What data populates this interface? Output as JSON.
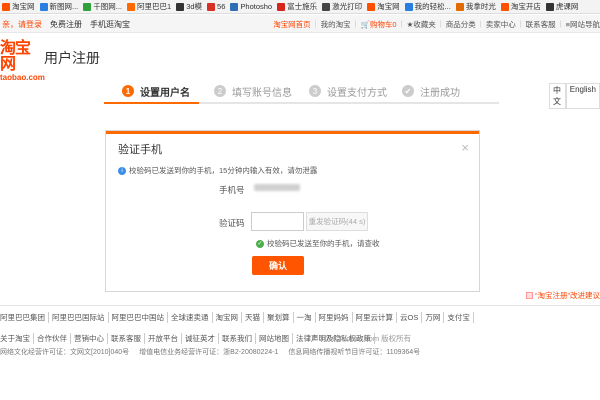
{
  "bookmarks": [
    {
      "label": "淘宝网",
      "color": "#ff5000"
    },
    {
      "label": "新图网...",
      "color": "#2a7de1"
    },
    {
      "label": "千图网...",
      "color": "#30a13a"
    },
    {
      "label": "阿里巴巴1",
      "color": "#ff6a00"
    },
    {
      "label": "3d模",
      "color": "#333333"
    },
    {
      "label": "56",
      "color": "#d93025"
    },
    {
      "label": "Photosho",
      "color": "#2c6fb5"
    },
    {
      "label": "富士施乐",
      "color": "#d6251b"
    },
    {
      "label": "激光打印",
      "color": "#444444"
    },
    {
      "label": "淘宝网",
      "color": "#ff5000"
    },
    {
      "label": "我的轻松...",
      "color": "#2a7de1"
    },
    {
      "label": "我拿时光",
      "color": "#e26b00"
    },
    {
      "label": "淘宝开店",
      "color": "#ff5000"
    },
    {
      "label": "虎课网",
      "color": "#333333"
    }
  ],
  "topnav": {
    "greeting": "亲，请登录",
    "register": "免费注册",
    "mobile": "手机逛淘宝",
    "right": [
      "淘宝网首页",
      "我的淘宝",
      "购物车0",
      "收藏夹",
      "商品分类",
      "卖家中心",
      "联系客服",
      "网站导航"
    ]
  },
  "header": {
    "logo_cn": "淘宝网",
    "logo_en": "taobao.com",
    "title": "用户注册"
  },
  "steps": [
    {
      "num": "1",
      "label": "设置用户名",
      "active": true
    },
    {
      "num": "2",
      "label": "填写账号信息",
      "active": false
    },
    {
      "num": "3",
      "label": "设置支付方式",
      "active": false
    },
    {
      "num": "✔",
      "label": "注册成功",
      "active": false
    }
  ],
  "lang": {
    "zh": "中文",
    "en": "English"
  },
  "dialog": {
    "title": "验证手机",
    "close_icon": "×",
    "info_text": "校验码已发送到你的手机，15分钟内输入有效，请勿泄露",
    "phone_label": "手机号",
    "code_label": "验证码",
    "code_placeholder": "",
    "resend_label": "重发验证码(44 s)",
    "sent_ok": "校验码已发送至你的手机，请查收",
    "confirm_label": "确认"
  },
  "feedback": "“淘宝注册”改进建议",
  "footer_links": [
    "阿里巴巴集团",
    "阿里巴巴国际站",
    "阿里巴巴中国站",
    "全球速卖通",
    "淘宝网",
    "天猫",
    "聚划算",
    "一淘",
    "阿里妈妈",
    "阿里云计算",
    "云OS",
    "万网",
    "支付宝"
  ],
  "footer_links2": [
    "关于淘宝",
    "合作伙伴",
    "营销中心",
    "联系客服",
    "开放平台",
    "诚征英才",
    "联系我们",
    "网站地图",
    "法律声明及隐私权政策"
  ],
  "copyright": "© 2018 Taobao.com 版权所有",
  "license": [
    "网络文化经营许可证：文网文[2010]040号",
    "增值电信业务经营许可证：浙B2-20080224-1",
    "信息网络传播视听节目许可证：1109364号"
  ],
  "colors": {
    "accent": "#ff6a00",
    "brand": "#ff4400",
    "button": "#ff5500"
  }
}
